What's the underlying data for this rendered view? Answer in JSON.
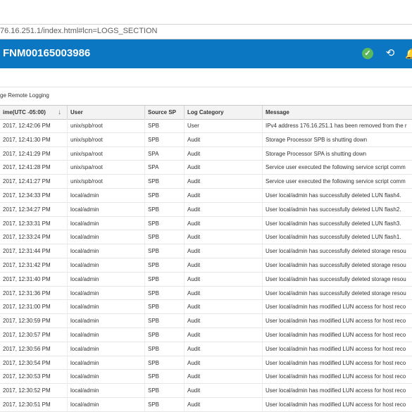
{
  "browser": {
    "url": "76.16.251.1/index.html#lcn=LOGS_SECTION"
  },
  "header": {
    "system_name": "FNM00165003986"
  },
  "toolbar": {
    "remote_logging_label": "ge Remote Logging"
  },
  "table": {
    "columns": [
      "ime(UTC -05:00)",
      "User",
      "Source SP",
      "Log Category",
      "Message"
    ],
    "rows": [
      [
        "2017, 12:42:06 PM",
        "unix/spb/root",
        "SPB",
        "User",
        "IPv4 address 176.16.251.1 has been removed from the r"
      ],
      [
        "2017, 12:41:30 PM",
        "unix/spb/root",
        "SPB",
        "Audit",
        "Storage Processor SPB is shutting down"
      ],
      [
        "2017, 12:41:29 PM",
        "unix/spa/root",
        "SPA",
        "Audit",
        "Storage Processor SPA is shutting down"
      ],
      [
        "2017, 12:41:28 PM",
        "unix/spa/root",
        "SPA",
        "Audit",
        "Service user executed the following service script comm"
      ],
      [
        "2017, 12:41:27 PM",
        "unix/spb/root",
        "SPB",
        "Audit",
        "Service user executed the following service script comm"
      ],
      [
        "2017, 12:34:33 PM",
        "local/admin",
        "SPB",
        "Audit",
        "User local/admin has successfully deleted LUN flash4."
      ],
      [
        "2017, 12:34:27 PM",
        "local/admin",
        "SPB",
        "Audit",
        "User local/admin has successfully deleted LUN flash2."
      ],
      [
        "2017, 12:33:31 PM",
        "local/admin",
        "SPB",
        "Audit",
        "User local/admin has successfully deleted LUN flash3."
      ],
      [
        "2017, 12:33:24 PM",
        "local/admin",
        "SPB",
        "Audit",
        "User local/admin has successfully deleted LUN flash1."
      ],
      [
        "2017, 12:31:44 PM",
        "local/admin",
        "SPB",
        "Audit",
        "User local/admin has successfully deleted storage resou"
      ],
      [
        "2017, 12:31:42 PM",
        "local/admin",
        "SPB",
        "Audit",
        "User local/admin has successfully deleted storage resou"
      ],
      [
        "2017, 12:31:40 PM",
        "local/admin",
        "SPB",
        "Audit",
        "User local/admin has successfully deleted storage resou"
      ],
      [
        "2017, 12:31:36 PM",
        "local/admin",
        "SPB",
        "Audit",
        "User local/admin has successfully deleted storage resou"
      ],
      [
        "2017, 12:31:00 PM",
        "local/admin",
        "SPB",
        "Audit",
        "User local/admin has modified LUN access for host reco"
      ],
      [
        "2017, 12:30:59 PM",
        "local/admin",
        "SPB",
        "Audit",
        "User local/admin has modified LUN access for host reco"
      ],
      [
        "2017, 12:30:57 PM",
        "local/admin",
        "SPB",
        "Audit",
        "User local/admin has modified LUN access for host reco"
      ],
      [
        "2017, 12:30:56 PM",
        "local/admin",
        "SPB",
        "Audit",
        "User local/admin has modified LUN access for host reco"
      ],
      [
        "2017, 12:30:54 PM",
        "local/admin",
        "SPB",
        "Audit",
        "User local/admin has modified LUN access for host reco"
      ],
      [
        "2017, 12:30:53 PM",
        "local/admin",
        "SPB",
        "Audit",
        "User local/admin has modified LUN access for host reco"
      ],
      [
        "2017, 12:30:52 PM",
        "local/admin",
        "SPB",
        "Audit",
        "User local/admin has modified LUN access for host reco"
      ],
      [
        "2017, 12:30:51 PM",
        "local/admin",
        "SPB",
        "Audit",
        "User local/admin has modified LUN access for host reco"
      ]
    ]
  },
  "icons": {
    "status": "check-circle-icon",
    "history": "history-icon",
    "alerts": "bell-icon"
  },
  "colors": {
    "header_bg": "#0b76c1",
    "status_ok": "#5cb85c"
  }
}
